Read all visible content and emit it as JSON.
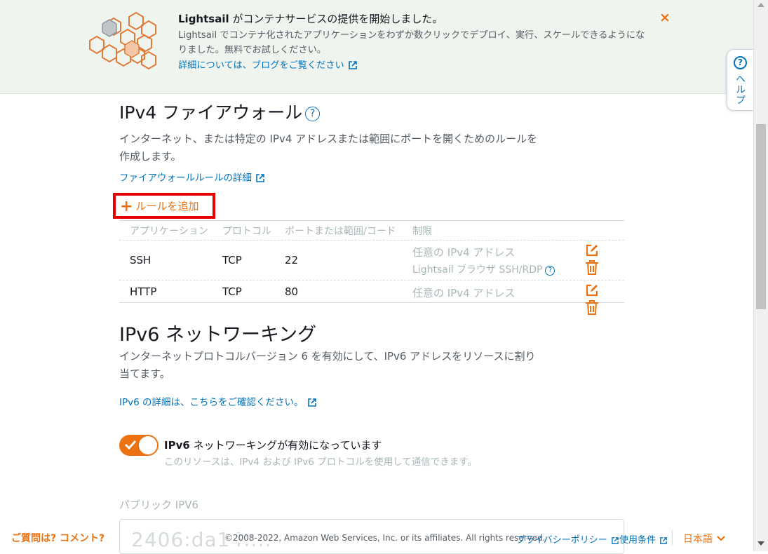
{
  "banner": {
    "title_brand": "Lightsail",
    "title_rest": " がコンテナサービスの提供を開始しました。",
    "description": "Lightsail でコンテナ化されたアプリケーションをわずか数クリックでデプロイ、実行、スケールできるようになりました。無料でお試しください。",
    "link": "詳細については、ブログをご覧ください",
    "close": "×"
  },
  "help_tab": {
    "label": "ヘルプ",
    "icon": "?"
  },
  "firewall_ipv4": {
    "title": "IPv4 ファイアウォール",
    "info_icon": "?",
    "description": "インターネット、または特定の IPv4 アドレスまたは範囲にポートを開くためのルールを作成します。",
    "details_link": "ファイアウォールルールの詳細",
    "add_rule": "ルールを追加",
    "columns": [
      "アプリケーション",
      "プロトコル",
      "ポートまたは範囲/コード",
      "制限"
    ],
    "rows": [
      {
        "application": "SSH",
        "protocol": "TCP",
        "port": "22",
        "restriction": "任意の IPv4 アドレス",
        "restriction2": "Lightsail ブラウザ SSH/RDP"
      },
      {
        "application": "HTTP",
        "protocol": "TCP",
        "port": "80",
        "restriction": "任意の IPv4 アドレス"
      }
    ]
  },
  "ipv6": {
    "title": "IPv6 ネットワーキング",
    "description": "インターネットプロトコルバージョン 6 を有効にして、IPv6 アドレスをリソースに割り当てます。",
    "details_link": "IPv6 の詳細は、こちらをご確認ください。",
    "toggle_bold": "IPv6",
    "toggle_label": " ネットワーキングが有効になっています",
    "toggle_enabled": true,
    "toggle_sub": "このリソースは、IPv4 および IPv6 プロトコルを使用して通信できます。",
    "public_label": "パブリック IPV6",
    "public_value": "2406:da14:..."
  },
  "footer": {
    "question": "ご質問は? コメント?",
    "copyright": "©2008-2022, Amazon Web Services, Inc. or its affiliates. All rights reserved.",
    "privacy": "プライバシーポリシー",
    "terms": "使用条件",
    "language": "日本語"
  },
  "colors": {
    "accent": "#ec7211",
    "link": "#0073bb",
    "highlight": "#e60000"
  }
}
